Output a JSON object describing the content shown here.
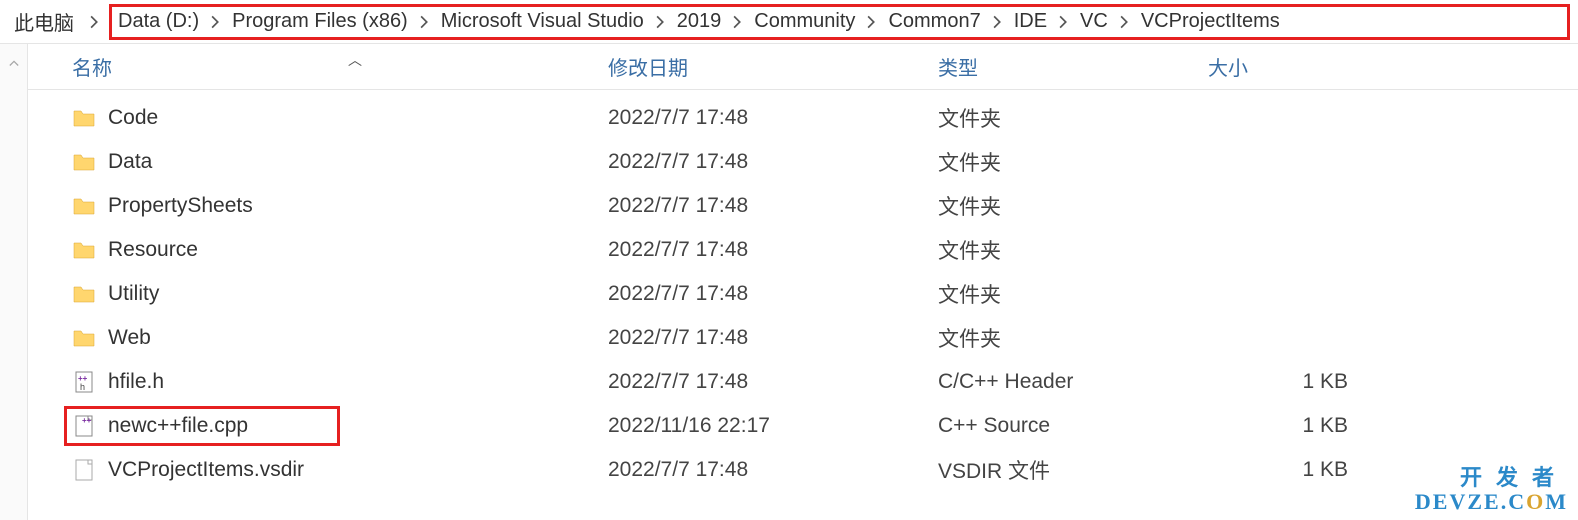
{
  "breadcrumb": {
    "root": "此电脑",
    "items": [
      "Data (D:)",
      "Program Files (x86)",
      "Microsoft Visual Studio",
      "2019",
      "Community",
      "Common7",
      "IDE",
      "VC",
      "VCProjectItems"
    ]
  },
  "columns": {
    "name": "名称",
    "date": "修改日期",
    "type": "类型",
    "size": "大小"
  },
  "rows": [
    {
      "icon": "folder",
      "name": "Code",
      "date": "2022/7/7 17:48",
      "type": "文件夹",
      "size": ""
    },
    {
      "icon": "folder",
      "name": "Data",
      "date": "2022/7/7 17:48",
      "type": "文件夹",
      "size": ""
    },
    {
      "icon": "folder",
      "name": "PropertySheets",
      "date": "2022/7/7 17:48",
      "type": "文件夹",
      "size": ""
    },
    {
      "icon": "folder",
      "name": "Resource",
      "date": "2022/7/7 17:48",
      "type": "文件夹",
      "size": ""
    },
    {
      "icon": "folder",
      "name": "Utility",
      "date": "2022/7/7 17:48",
      "type": "文件夹",
      "size": ""
    },
    {
      "icon": "folder",
      "name": "Web",
      "date": "2022/7/7 17:48",
      "type": "文件夹",
      "size": ""
    },
    {
      "icon": "hfile",
      "name": "hfile.h",
      "date": "2022/7/7 17:48",
      "type": "C/C++ Header",
      "size": "1 KB"
    },
    {
      "icon": "cpp",
      "name": "newc++file.cpp",
      "date": "2022/11/16 22:17",
      "type": "C++ Source",
      "size": "1 KB",
      "highlight": true
    },
    {
      "icon": "file",
      "name": "VCProjectItems.vsdir",
      "date": "2022/7/7 17:48",
      "type": "VSDIR 文件",
      "size": "1 KB"
    }
  ],
  "watermark": {
    "line1": "开发者",
    "line2_a": "DEVZE.C",
    "line2_b": "O",
    "line2_c": "M"
  }
}
